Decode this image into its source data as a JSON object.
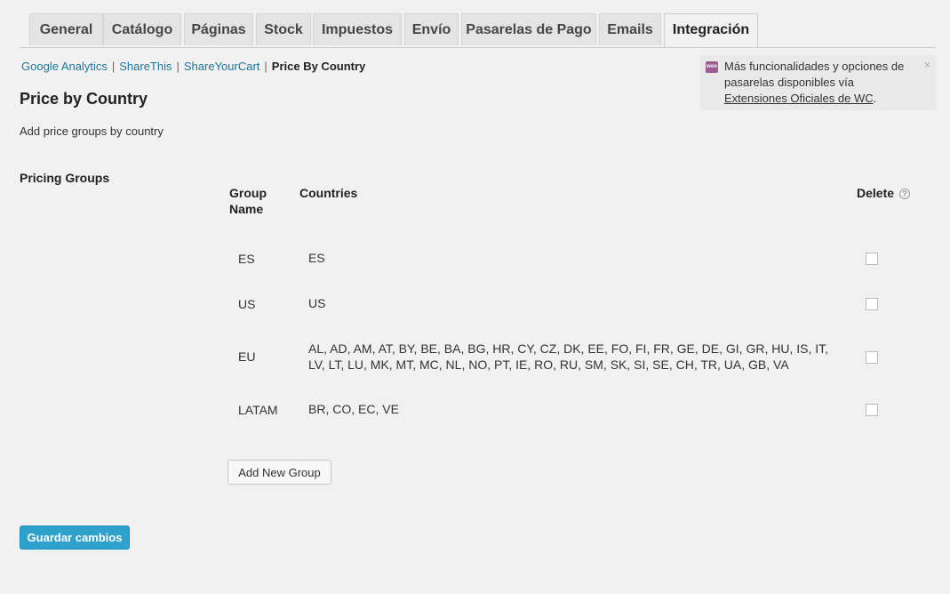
{
  "tabs": [
    {
      "label": "General",
      "active": false
    },
    {
      "label": "Catálogo",
      "active": false
    },
    {
      "label": "Páginas",
      "active": false
    },
    {
      "label": "Stock",
      "active": false
    },
    {
      "label": "Impuestos",
      "active": false
    },
    {
      "label": "Envío",
      "active": false
    },
    {
      "label": "Pasarelas de Pago",
      "active": false
    },
    {
      "label": "Emails",
      "active": false
    },
    {
      "label": "Integración",
      "active": true
    }
  ],
  "subnav": {
    "links": [
      "Google Analytics",
      "ShareThis",
      "ShareYourCart"
    ],
    "current": "Price By Country",
    "separator": "|"
  },
  "notice": {
    "icon_text": "woo",
    "text": "Más funcionalidades y opciones de pasarelas disponibles vía",
    "link": "Extensiones Oficiales de WC",
    "period": ".",
    "close": "×"
  },
  "section": {
    "title": "Price by Country",
    "description": "Add price groups by country",
    "field_label": "Pricing Groups"
  },
  "table": {
    "headers": {
      "group_name_line1": "Group",
      "group_name_line2": "Name",
      "countries": "Countries",
      "delete": "Delete",
      "help_icon": "?"
    },
    "rows": [
      {
        "name": "ES",
        "countries": "ES",
        "checked": false
      },
      {
        "name": "US",
        "countries": "US",
        "checked": false
      },
      {
        "name": "EU",
        "countries": "AL, AD, AM, AT, BY, BE, BA, BG, HR, CY, CZ, DK, EE, FO, FI, FR, GE, DE, GI, GR, HU, IS, IT, LV, LT, LU, MK, MT, MC, NL, NO, PT, IE, RO, RU, SM, SK, SI, SE, CH, TR, UA, GB, VA",
        "checked": false
      },
      {
        "name": "LATAM",
        "countries": "BR, CO, EC, VE",
        "checked": false
      }
    ]
  },
  "buttons": {
    "add_group": "Add New Group",
    "save": "Guardar cambios"
  },
  "colors": {
    "link": "#21759b",
    "primary_button": "#2ea2cc",
    "woo_brand": "#9b5c8f",
    "background": "#f1f1f1"
  }
}
